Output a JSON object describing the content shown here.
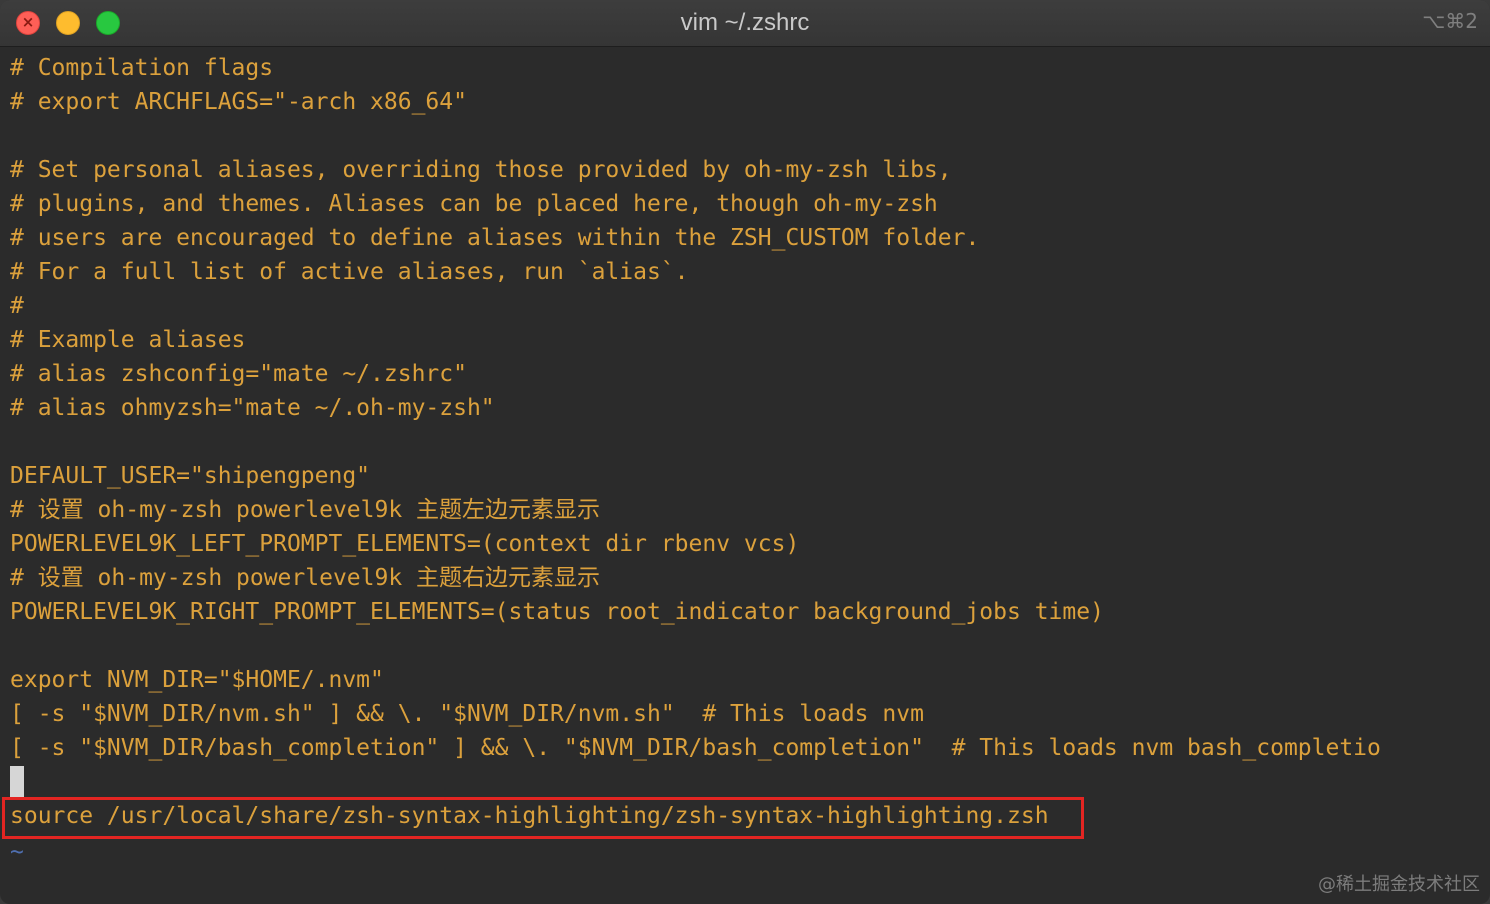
{
  "window": {
    "title": "vim ~/.zshrc",
    "shortcut": "⌥⌘2",
    "close_glyph": "×",
    "traffic_colors": {
      "close": "#fe5f57",
      "minimize": "#febc2e",
      "maximize": "#28c840"
    }
  },
  "editor": {
    "text_color": "#dca13c",
    "highlight_color": "#e32522",
    "tilde_color": "#4f6fb0",
    "lines": [
      "# Compilation flags",
      "# export ARCHFLAGS=\"-arch x86_64\"",
      "",
      "# Set personal aliases, overriding those provided by oh-my-zsh libs,",
      "# plugins, and themes. Aliases can be placed here, though oh-my-zsh",
      "# users are encouraged to define aliases within the ZSH_CUSTOM folder.",
      "# For a full list of active aliases, run `alias`.",
      "#",
      "# Example aliases",
      "# alias zshconfig=\"mate ~/.zshrc\"",
      "# alias ohmyzsh=\"mate ~/.oh-my-zsh\"",
      "",
      "DEFAULT_USER=\"shipengpeng\"",
      "# 设置 oh-my-zsh powerlevel9k 主题左边元素显示",
      "POWERLEVEL9K_LEFT_PROMPT_ELEMENTS=(context dir rbenv vcs)",
      "# 设置 oh-my-zsh powerlevel9k 主题右边元素显示",
      "POWERLEVEL9K_RIGHT_PROMPT_ELEMENTS=(status root_indicator background_jobs time)",
      "",
      "export NVM_DIR=\"$HOME/.nvm\"",
      "[ -s \"$NVM_DIR/nvm.sh\" ] && \\. \"$NVM_DIR/nvm.sh\"  # This loads nvm",
      "[ -s \"$NVM_DIR/bash_completion\" ] && \\. \"$NVM_DIR/bash_completion\"  # This loads nvm bash_completio",
      "",
      "source /usr/local/share/zsh-syntax-highlighting/zsh-syntax-highlighting.zsh"
    ],
    "tilde": "~"
  },
  "watermark": "@稀土掘金技术社区"
}
